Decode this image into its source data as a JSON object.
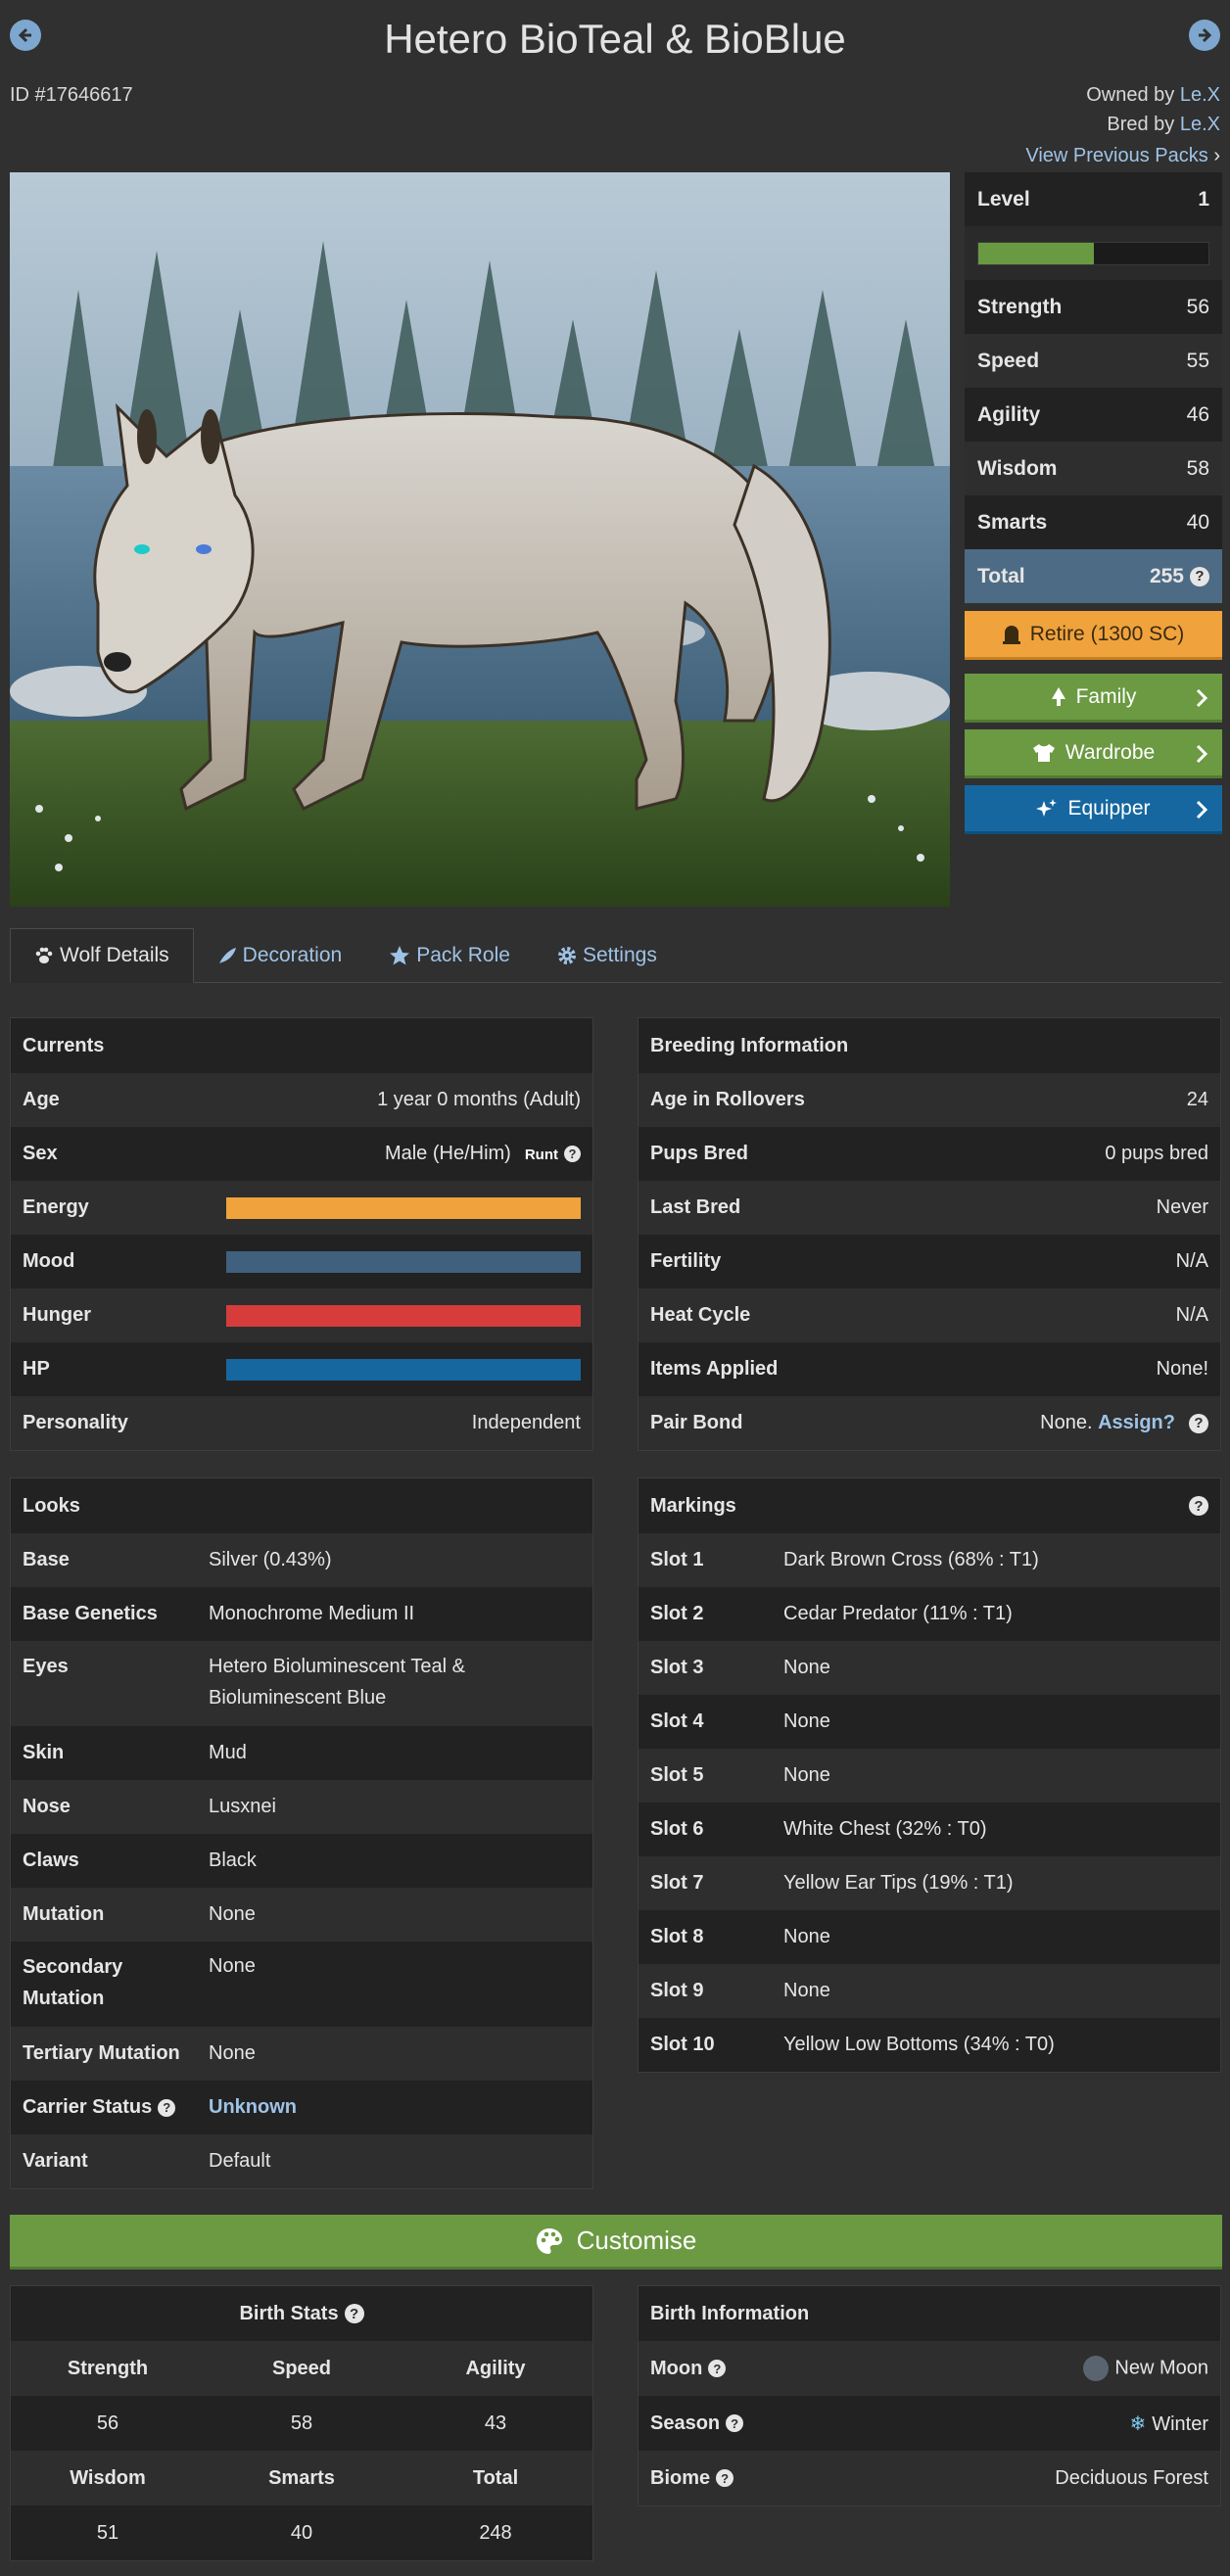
{
  "header": {
    "title": "Hetero BioTeal & BioBlue",
    "id_text": "ID #17646617",
    "owned_prefix": "Owned by ",
    "owner": "Le.X",
    "bred_prefix": "Bred by ",
    "breeder": "Le.X",
    "view_previous": "View Previous Packs"
  },
  "stats": {
    "level_label": "Level",
    "level": "1",
    "xp_percent": 50,
    "rows": [
      {
        "label": "Strength",
        "value": "56"
      },
      {
        "label": "Speed",
        "value": "55"
      },
      {
        "label": "Agility",
        "value": "46"
      },
      {
        "label": "Wisdom",
        "value": "58"
      },
      {
        "label": "Smarts",
        "value": "40"
      }
    ],
    "total_label": "Total",
    "total": "255"
  },
  "buttons": {
    "retire": "Retire (1300 SC)",
    "family": "Family",
    "wardrobe": "Wardrobe",
    "equipper": "Equipper",
    "customise": "Customise"
  },
  "tabs": [
    {
      "label": "Wolf Details"
    },
    {
      "label": "Decoration"
    },
    {
      "label": "Pack Role"
    },
    {
      "label": "Settings"
    }
  ],
  "currents": {
    "title": "Currents",
    "age_label": "Age",
    "age": "1 year 0 months (Adult)",
    "sex_label": "Sex",
    "sex": "Male (He/Him)",
    "runt": "Runt",
    "energy_label": "Energy",
    "mood_label": "Mood",
    "hunger_label": "Hunger",
    "hp_label": "HP",
    "personality_label": "Personality",
    "personality": "Independent",
    "colors": {
      "energy": "#f0a33c",
      "mood": "#3f617d",
      "hunger": "#d63d3a",
      "hp": "#1667a0"
    },
    "levels": {
      "energy": 100,
      "mood": 100,
      "hunger": 100,
      "hp": 100
    }
  },
  "breeding": {
    "title": "Breeding Information",
    "rows": [
      {
        "label": "Age in Rollovers",
        "value": "24"
      },
      {
        "label": "Pups Bred",
        "value": "0 pups bred"
      },
      {
        "label": "Last Bred",
        "value": "Never"
      },
      {
        "label": "Fertility",
        "value": "N/A"
      },
      {
        "label": "Heat Cycle",
        "value": "N/A"
      },
      {
        "label": "Items Applied",
        "value": "None!"
      }
    ],
    "pair_bond_label": "Pair Bond",
    "pair_bond_value": "None.",
    "assign": "Assign?"
  },
  "looks": {
    "title": "Looks",
    "base_label": "Base",
    "base": "Silver (0.43%)",
    "genetics_label": "Base Genetics",
    "genetics": "Monochrome Medium II",
    "eyes_label": "Eyes",
    "eyes_1": "Hetero Bioluminescent Teal &",
    "eyes_2": "Bioluminescent Blue",
    "skin_label": "Skin",
    "skin": "Mud",
    "nose_label": "Nose",
    "nose": "Lusxnei",
    "claws_label": "Claws",
    "claws": "Black",
    "mutation_label": "Mutation",
    "mutation": "None",
    "secondary_label_1": "Secondary",
    "secondary_label_2": "Mutation",
    "secondary": "None",
    "tertiary_label": "Tertiary Mutation",
    "tertiary": "None",
    "carrier_label": "Carrier Status",
    "carrier": "Unknown",
    "variant_label": "Variant",
    "variant": "Default"
  },
  "markings": {
    "title": "Markings",
    "slots": [
      {
        "label": "Slot 1",
        "value": "Dark Brown Cross (68% : T1)"
      },
      {
        "label": "Slot 2",
        "value": "Cedar Predator (11% : T1)"
      },
      {
        "label": "Slot 3",
        "value": "None"
      },
      {
        "label": "Slot 4",
        "value": "None"
      },
      {
        "label": "Slot 5",
        "value": "None"
      },
      {
        "label": "Slot 6",
        "value": "White Chest (32% : T0)"
      },
      {
        "label": "Slot 7",
        "value": "Yellow Ear Tips (19% : T1)"
      },
      {
        "label": "Slot 8",
        "value": "None"
      },
      {
        "label": "Slot 9",
        "value": "None"
      },
      {
        "label": "Slot 10",
        "value": "Yellow Low Bottoms (34% : T0)"
      }
    ]
  },
  "birth_stats": {
    "title": "Birth Stats",
    "h1": "Strength",
    "h2": "Speed",
    "h3": "Agility",
    "v1": "56",
    "v2": "58",
    "v3": "43",
    "h4": "Wisdom",
    "h5": "Smarts",
    "h6": "Total",
    "v4": "51",
    "v5": "40",
    "v6": "248"
  },
  "birth_info": {
    "title": "Birth Information",
    "moon_label": "Moon",
    "moon": "New Moon",
    "season_label": "Season",
    "season": "Winter",
    "biome_label": "Biome",
    "biome": "Deciduous Forest"
  }
}
